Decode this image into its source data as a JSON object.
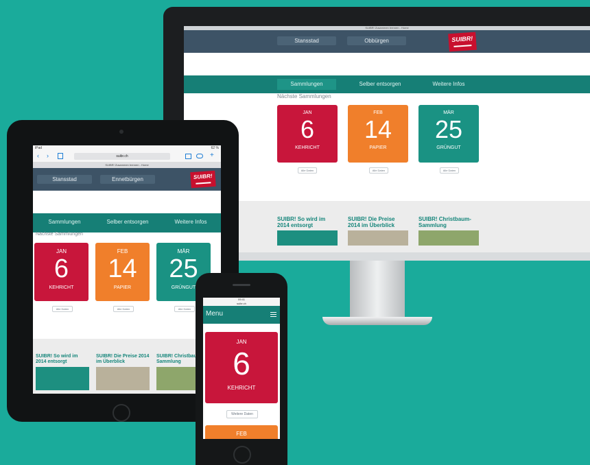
{
  "colors": {
    "background": "#1aab9b",
    "kehricht": "#c8163b",
    "papier": "#f07f2b",
    "gruengut": "#1a9283",
    "header": "#3d5366",
    "nav": "#167f76"
  },
  "desktop": {
    "titlebar": "SUIBR! Zusammen trennen - Home",
    "header_buttons": [
      "Stansstad",
      "Obbürgen"
    ],
    "logo": "SUIBR!",
    "nav": [
      "Sammlungen",
      "Selber entsorgen",
      "Weitere Infos"
    ],
    "section_title": "Nächste Sammlungen",
    "cards": [
      {
        "month": "JAN",
        "day": "6",
        "category": "KEHRICHT"
      },
      {
        "month": "FEB",
        "day": "14",
        "category": "PAPIER"
      },
      {
        "month": "MÄR",
        "day": "25",
        "category": "GRÜNGUT"
      }
    ],
    "more_label": "Alle Daten",
    "teasers": [
      "SUIBR! So wird im 2014 entsorgt",
      "SUIBR! Die Preise 2014 im Überblick",
      "SUIBR! Christbaum-Sammlung"
    ]
  },
  "tablet": {
    "status_left": "iPad",
    "status_right": "62 %",
    "url": "suibr.ch",
    "page_title": "SUIBR! Zusammen trennen - Home",
    "header_buttons": [
      "Stansstad",
      "Ennetbürgen"
    ],
    "logo": "SUIBR!",
    "nav": [
      "Sammlungen",
      "Selber entsorgen",
      "Weitere Infos"
    ],
    "section_title": "Nächste Sammlungen",
    "cards": [
      {
        "month": "JAN",
        "day": "6",
        "category": "KEHRICHT"
      },
      {
        "month": "FEB",
        "day": "14",
        "category": "PAPIER"
      },
      {
        "month": "MÄR",
        "day": "25",
        "category": "GRÜNGUT"
      }
    ],
    "more_label": "Alle Daten",
    "teasers": [
      "SUIBR! So wird im 2014 entsorgt",
      "SUIBR! Die Preise 2014 im Überblick",
      "SUIBR! Christbaum Sammlung"
    ]
  },
  "phone": {
    "status_time": "09:41",
    "url": "suibr.ch",
    "menu": "Menu",
    "cards": [
      {
        "month": "JAN",
        "day": "6",
        "category": "KEHRICHT"
      },
      {
        "month": "FEB"
      }
    ],
    "more_label": "Weitere Daten"
  }
}
